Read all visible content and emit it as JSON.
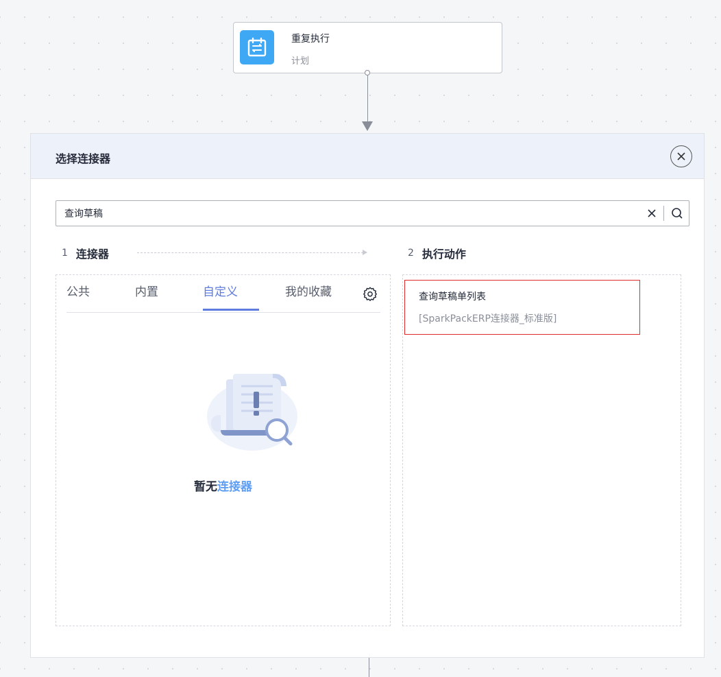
{
  "trigger": {
    "title": "重复执行",
    "subtitle": "计划",
    "icon": "calendar-schedule-icon",
    "icon_color": "#3ea8f5"
  },
  "panel": {
    "title": "选择连接器",
    "search": {
      "value": "查询草稿",
      "placeholder": ""
    },
    "steps": [
      {
        "num": "1",
        "label": "连接器"
      },
      {
        "num": "2",
        "label": "执行动作"
      }
    ],
    "tabs": [
      {
        "label": "公共",
        "active": false
      },
      {
        "label": "内置",
        "active": false
      },
      {
        "label": "自定义",
        "active": true
      },
      {
        "label": "我的收藏",
        "active": false
      }
    ],
    "empty": {
      "prefix": "暂无",
      "link": "连接器"
    },
    "actions": [
      {
        "name": "查询草稿单列表",
        "connector": "[SparkPackERP连接器_标准版]"
      }
    ]
  },
  "colors": {
    "accent": "#5e7ce0",
    "link": "#5e9ef5",
    "highlight_border": "#e02b2b",
    "header_bg": "#edf1fa"
  }
}
